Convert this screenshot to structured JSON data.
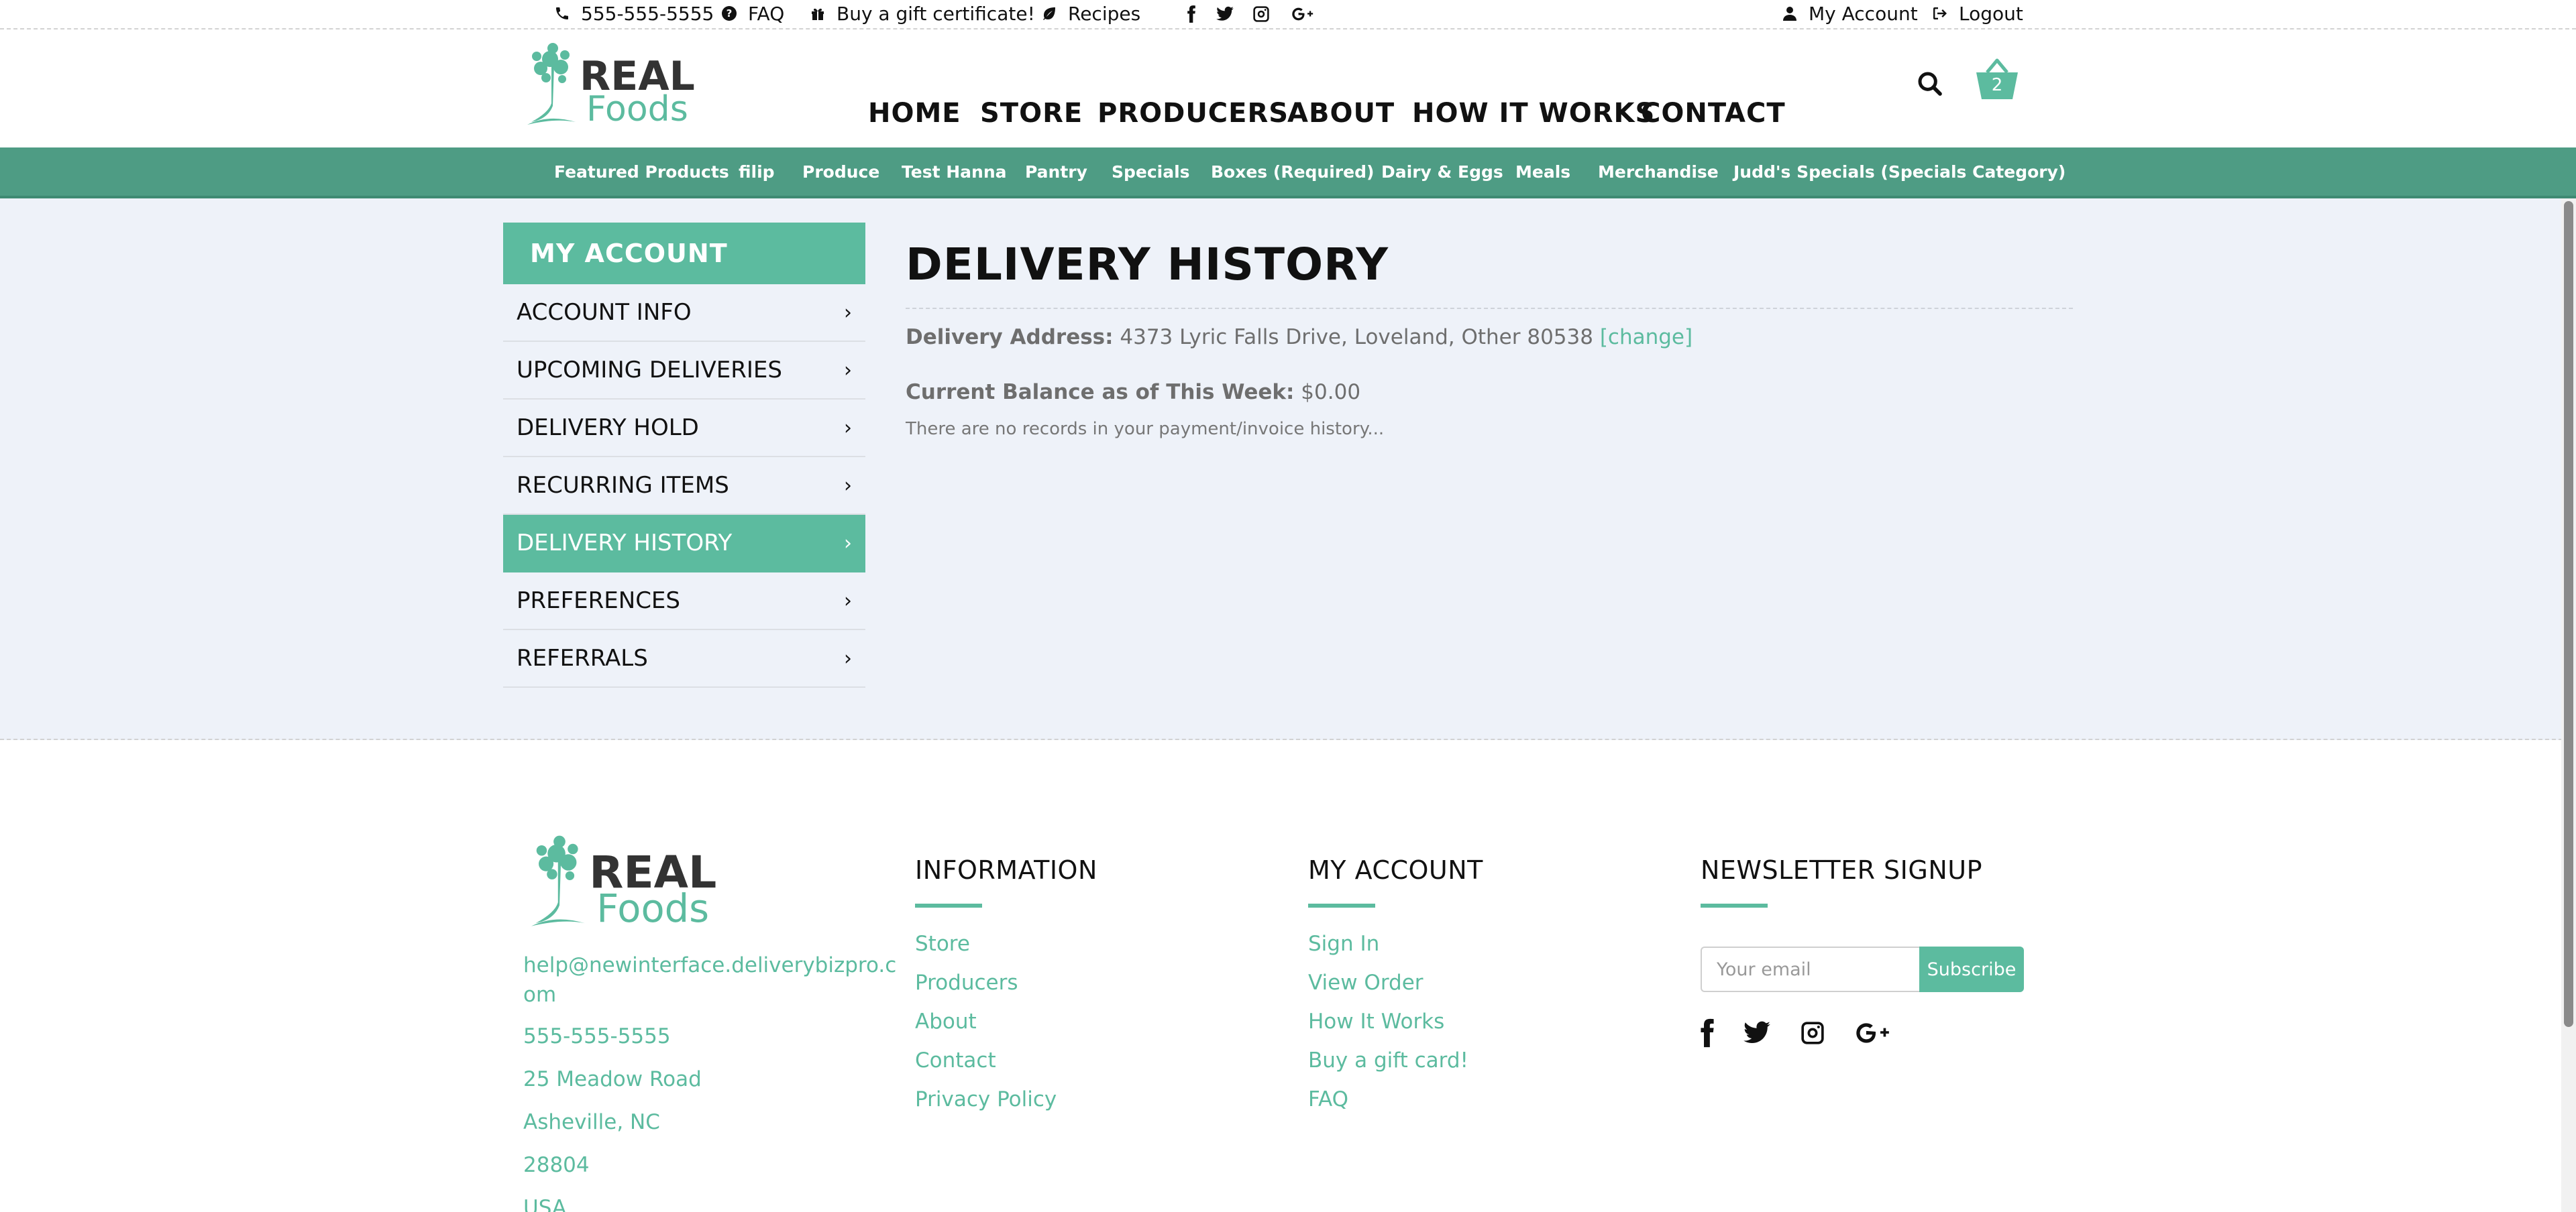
{
  "topbar": {
    "phone": "555-555-5555",
    "faq": "FAQ",
    "gift": "Buy a gift certificate!",
    "recipes": "Recipes",
    "my_account": "My Account",
    "logout": "Logout",
    "social_icons": [
      "facebook-icon",
      "twitter-icon",
      "instagram-icon",
      "google-plus-icon"
    ]
  },
  "brand": {
    "line1": "REAL",
    "line2": "Foods",
    "accent": "#5cbb9f",
    "dark": "#333333"
  },
  "nav": [
    "HOME",
    "STORE",
    "PRODUCERS",
    "ABOUT",
    "HOW IT WORKS",
    "CONTACT"
  ],
  "cart": {
    "count": "2"
  },
  "categories": [
    "Featured Products",
    "filip",
    "Produce",
    "Test Hanna",
    "Pantry",
    "Specials",
    "Boxes (Required)",
    "Dairy & Eggs",
    "Meals",
    "Merchandise",
    "Judd's Specials (Specials Category)"
  ],
  "sidebar": {
    "title": "MY ACCOUNT",
    "items": [
      {
        "label": "ACCOUNT INFO",
        "active": false
      },
      {
        "label": "UPCOMING DELIVERIES",
        "active": false
      },
      {
        "label": "DELIVERY HOLD",
        "active": false
      },
      {
        "label": "RECURRING ITEMS",
        "active": false
      },
      {
        "label": "DELIVERY HISTORY",
        "active": true
      },
      {
        "label": "PREFERENCES",
        "active": false
      },
      {
        "label": "REFERRALS",
        "active": false
      }
    ]
  },
  "content": {
    "title": "DELIVERY HISTORY",
    "address_label": "Delivery Address:",
    "address_value": "4373 Lyric Falls Drive, Loveland, Other 80538",
    "change_link": "[change]",
    "balance_label": "Current Balance as of This Week:",
    "balance_value": "$0.00",
    "empty_message": "There are no records in your payment/invoice history..."
  },
  "footer": {
    "email_line1": "help@newinterface.deliverybizpro.c",
    "email_line2": "om",
    "phone": "555-555-5555",
    "street": "25 Meadow Road",
    "city": "Asheville, NC",
    "zip": "28804",
    "country": "USA",
    "information": {
      "title": "INFORMATION",
      "links": [
        "Store",
        "Producers",
        "About",
        "Contact",
        "Privacy Policy"
      ]
    },
    "account": {
      "title": "MY ACCOUNT",
      "links": [
        "Sign In",
        "View Order",
        "How It Works",
        "Buy a gift card!",
        "FAQ"
      ]
    },
    "newsletter": {
      "title": "NEWSLETTER SIGNUP",
      "placeholder": "Your email",
      "button": "Subscribe"
    }
  }
}
